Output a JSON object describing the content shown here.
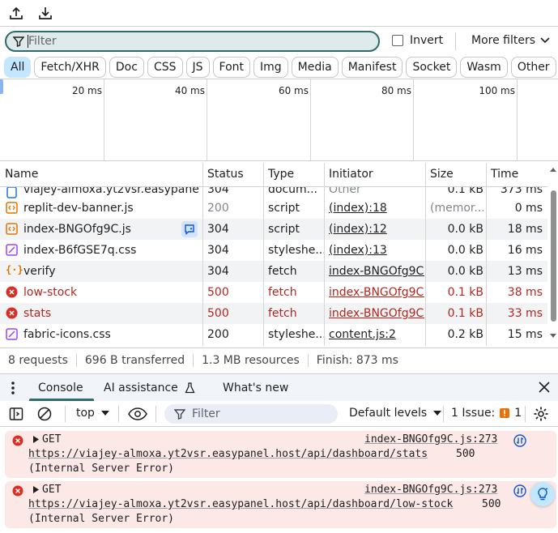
{
  "toolbar": {
    "upload_icon": "upload-icon",
    "download_icon": "download-icon"
  },
  "filter": {
    "placeholder": "Filter",
    "invert_label": "Invert",
    "more_filters_label": "More filters"
  },
  "type_chips": [
    "All",
    "Fetch/XHR",
    "Doc",
    "CSS",
    "JS",
    "Font",
    "Img",
    "Media",
    "Manifest",
    "Socket",
    "Wasm",
    "Other"
  ],
  "overview": {
    "ticks": [
      "20 ms",
      "40 ms",
      "60 ms",
      "80 ms",
      "100 ms"
    ]
  },
  "table": {
    "columns": [
      "Name",
      "Status",
      "Type",
      "Initiator",
      "Size",
      "Time"
    ],
    "partial_row": {
      "name": "viajey-almoxa.yt2vsr.easypanel....",
      "status": "304",
      "type": "docum...",
      "initiator": "Other",
      "size": "0.1 kB",
      "time": "373 ms"
    },
    "rows": [
      {
        "name": "replit-dev-banner.js",
        "status": "200",
        "type": "script",
        "initiator": "(index):18",
        "size": "(memor...",
        "time": "0 ms",
        "icon": "script-icon",
        "error": false
      },
      {
        "name": "index-BNGOfg9C.js",
        "status": "304",
        "type": "script",
        "initiator": "(index):12",
        "size": "0.0 kB",
        "time": "18 ms",
        "icon": "script-icon",
        "error": false
      },
      {
        "name": "index-B6fGSE7q.css",
        "status": "304",
        "type": "styleshe...",
        "initiator": "(index):13",
        "size": "0.0 kB",
        "time": "16 ms",
        "icon": "stylesheet-icon",
        "error": false
      },
      {
        "name": "verify",
        "status": "304",
        "type": "fetch",
        "initiator": "index-BNGOfg9C.js",
        "size": "0.0 kB",
        "time": "13 ms",
        "icon": "fetch-icon",
        "error": false
      },
      {
        "name": "low-stock",
        "status": "500",
        "type": "fetch",
        "initiator": "index-BNGOfg9C.js",
        "size": "0.1 kB",
        "time": "38 ms",
        "icon": "error-icon",
        "error": true
      },
      {
        "name": "stats",
        "status": "500",
        "type": "fetch",
        "initiator": "index-BNGOfg9C.js",
        "size": "0.1 kB",
        "time": "33 ms",
        "icon": "error-icon",
        "error": true
      },
      {
        "name": "fabric-icons.css",
        "status": "200",
        "type": "styleshe...",
        "initiator": "content.js:2",
        "size": "0.2 kB",
        "time": "15 ms",
        "icon": "stylesheet-icon",
        "error": false
      }
    ]
  },
  "summary": {
    "requests": "8 requests",
    "transferred": "696 B transferred",
    "resources": "1.3 MB resources",
    "finish": "Finish: 873 ms"
  },
  "drawer": {
    "tabs": [
      "Console",
      "AI assistance",
      "What's new"
    ],
    "active_tab": "Console"
  },
  "console_toolbar": {
    "context": "top",
    "filter_placeholder": "Filter",
    "levels": "Default levels",
    "issues_label": "1 Issue:",
    "issues_count": "1"
  },
  "messages": [
    {
      "method": "GET",
      "source": "index-BNGOfg9C.js:273",
      "url": "https://viajey-almoxa.yt2vsr.easypanel.host/api/dashboard/stats",
      "code": "500",
      "detail": "(Internal Server Error)"
    },
    {
      "method": "GET",
      "source": "index-BNGOfg9C.js:273",
      "url": "https://viajey-almoxa.yt2vsr.easypanel.host/api/dashboard/low-stock",
      "code": "500",
      "detail": "(Internal Server Error)"
    }
  ],
  "colors": {
    "accent": "#2f6b6b",
    "error": "#b3261e",
    "chip_active": "#c2e7ff",
    "error_bg": "#fce8e6"
  }
}
